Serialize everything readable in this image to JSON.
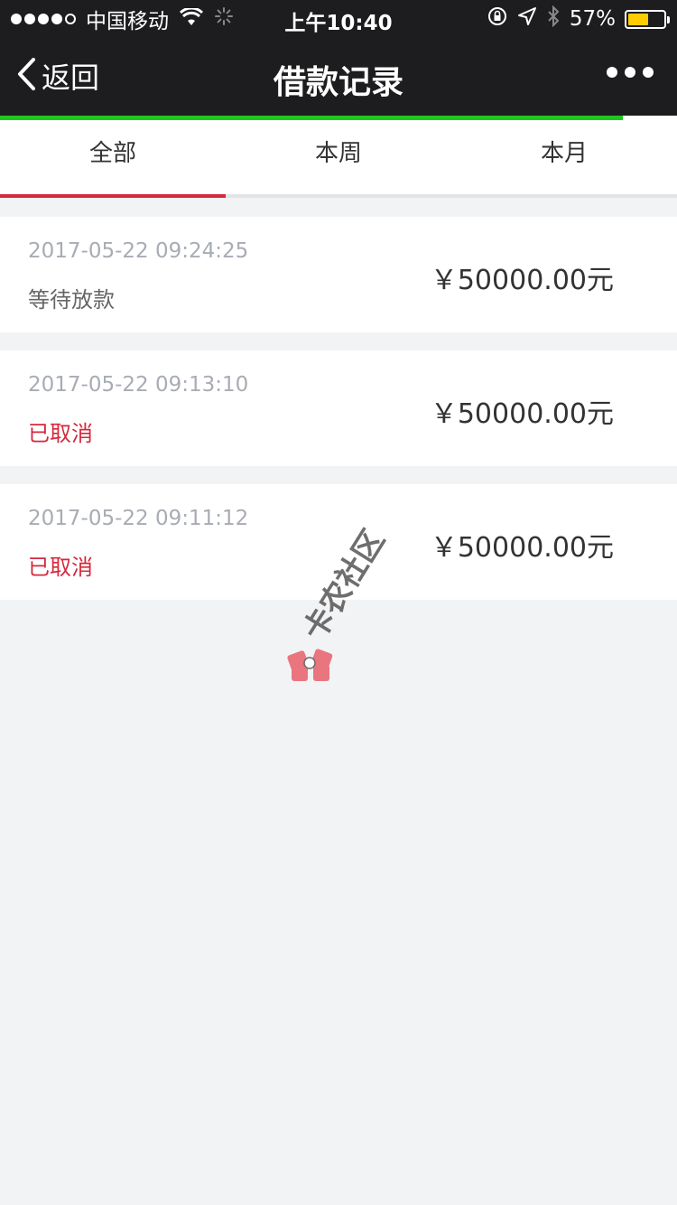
{
  "status_bar": {
    "carrier": "中国移动",
    "time": "上午10:40",
    "battery_percent": "57%",
    "battery_level": 0.57
  },
  "nav": {
    "back_label": "返回",
    "title": "借款记录"
  },
  "page_load_progress": 0.92,
  "tabs": [
    {
      "label": "全部"
    },
    {
      "label": "本周"
    },
    {
      "label": "本月"
    }
  ],
  "records": [
    {
      "date": "2017-05-22 09:24:25",
      "status": "等待放款",
      "amount": "￥50000.00元"
    },
    {
      "date": "2017-05-22 09:13:10",
      "status": "已取消",
      "amount": "￥50000.00元"
    },
    {
      "date": "2017-05-22 09:11:12",
      "status": "已取消",
      "amount": "￥50000.00元"
    }
  ],
  "watermark": {
    "text": "卡农社区"
  },
  "colors": {
    "accent_red": "#d6283c",
    "progress_green": "#1ec71e",
    "nav_bg": "#1d1d1f"
  }
}
